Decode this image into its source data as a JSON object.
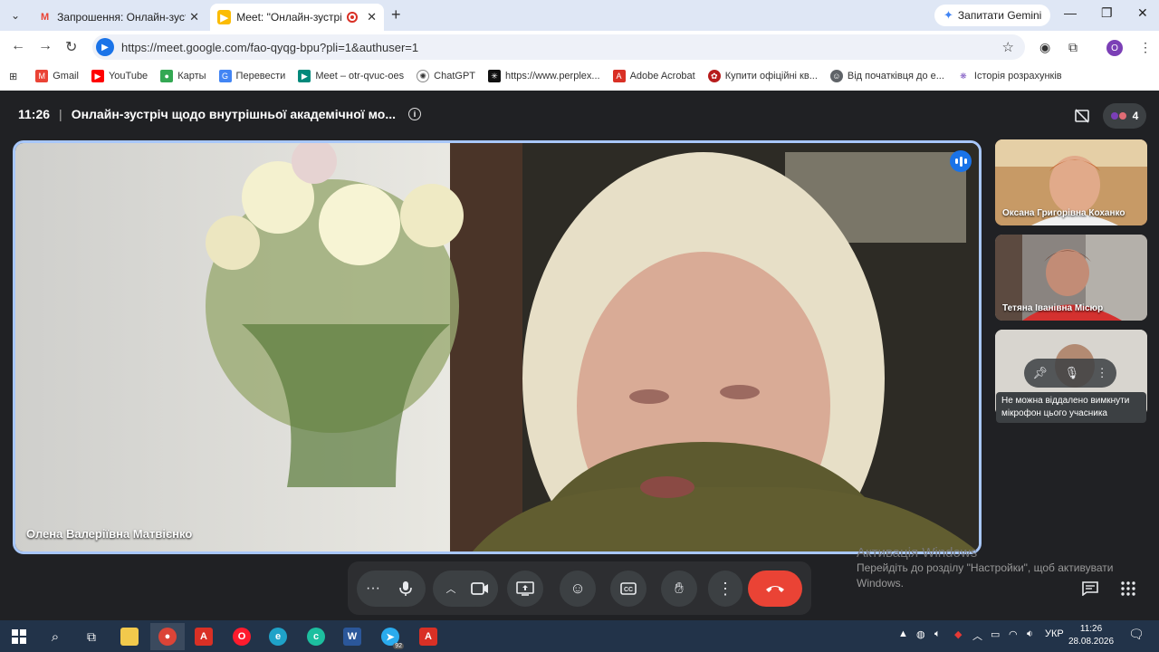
{
  "browser": {
    "tabs": [
      {
        "title": "Запрошення: Онлайн-зустріч",
        "icon": "gmail-icon",
        "active": false
      },
      {
        "title": "Meet: \"Онлайн-зустріч щод",
        "icon": "meet-icon",
        "active": true,
        "recording": true
      }
    ],
    "gemini_label": "Запитати Gemini",
    "url": "https://meet.google.com/fao-qyqg-bpu?pli=1&authuser=1",
    "profile_initial": "O",
    "bookmarks": [
      {
        "label": "Gmail",
        "icon": "gmail-icon",
        "color": "#ea4335"
      },
      {
        "label": "YouTube",
        "icon": "youtube-icon",
        "color": "#ff0000"
      },
      {
        "label": "Карты",
        "icon": "maps-icon",
        "color": "#34a853"
      },
      {
        "label": "Перевести",
        "icon": "translate-icon",
        "color": "#4285f4"
      },
      {
        "label": "Meet – otr-qvuc-oes",
        "icon": "meet-icon",
        "color": "#00897b"
      },
      {
        "label": "ChatGPT",
        "icon": "chatgpt-icon",
        "color": "#333333"
      },
      {
        "label": "https://www.perplex...",
        "icon": "perplexity-icon",
        "color": "#111111"
      },
      {
        "label": "Adobe Acrobat",
        "icon": "acrobat-icon",
        "color": "#d93025"
      },
      {
        "label": "Купити офіційні кв...",
        "icon": "ticket-icon",
        "color": "#b71c1c"
      },
      {
        "label": "Від початківця до е...",
        "icon": "course-icon",
        "color": "#5f6368"
      },
      {
        "label": "Історія розрахунків",
        "icon": "history-icon",
        "color": "#7e57c2"
      }
    ]
  },
  "meeting": {
    "time": "11:26",
    "title": "Онлайн-зустріч щодо внутрішньої академічної мо...",
    "participant_count": "4",
    "main_speaker": "Олена Валеріївна Матвієнко",
    "participants": [
      {
        "name": "Оксана Григорівна Коханко"
      },
      {
        "name": "Тетяна Іванівна Місюр"
      },
      {
        "name": ""
      }
    ],
    "tooltip": "Не можна віддалено вимкнути мікрофон цього учасника"
  },
  "activation": {
    "title": "Активація Windows",
    "subtitle": "Перейдіть до розділу \"Настройки\", щоб активувати Windows."
  },
  "taskbar": {
    "language": "УКР",
    "time": "11:26",
    "date": "28.08.2026",
    "telegram_badge": "92"
  }
}
